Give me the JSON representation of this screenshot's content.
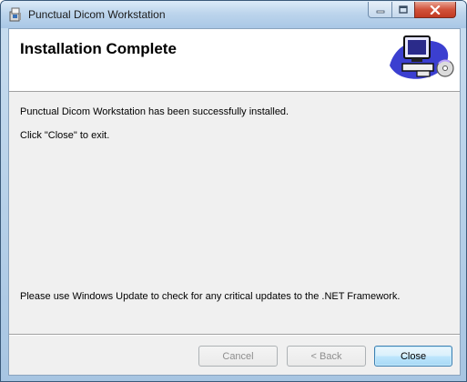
{
  "window": {
    "title": "Punctual Dicom Workstation",
    "app_icon": "installer-package-icon",
    "controls": {
      "minimize": "minimize-icon",
      "maximize": "maximize-icon",
      "close": "close-icon"
    }
  },
  "banner": {
    "title": "Installation Complete",
    "art": "computer-monitor-with-cd-icon"
  },
  "content": {
    "message": "Punctual Dicom Workstation has been successfully installed.",
    "instruction": "Click \"Close\" to exit.",
    "footer_note": "Please use Windows Update to check for any critical updates to the .NET Framework."
  },
  "buttons": {
    "cancel": "Cancel",
    "back": "< Back",
    "close": "Close"
  },
  "colors": {
    "close_button": "#c23a22",
    "default_button_border": "#3c7fb1"
  }
}
